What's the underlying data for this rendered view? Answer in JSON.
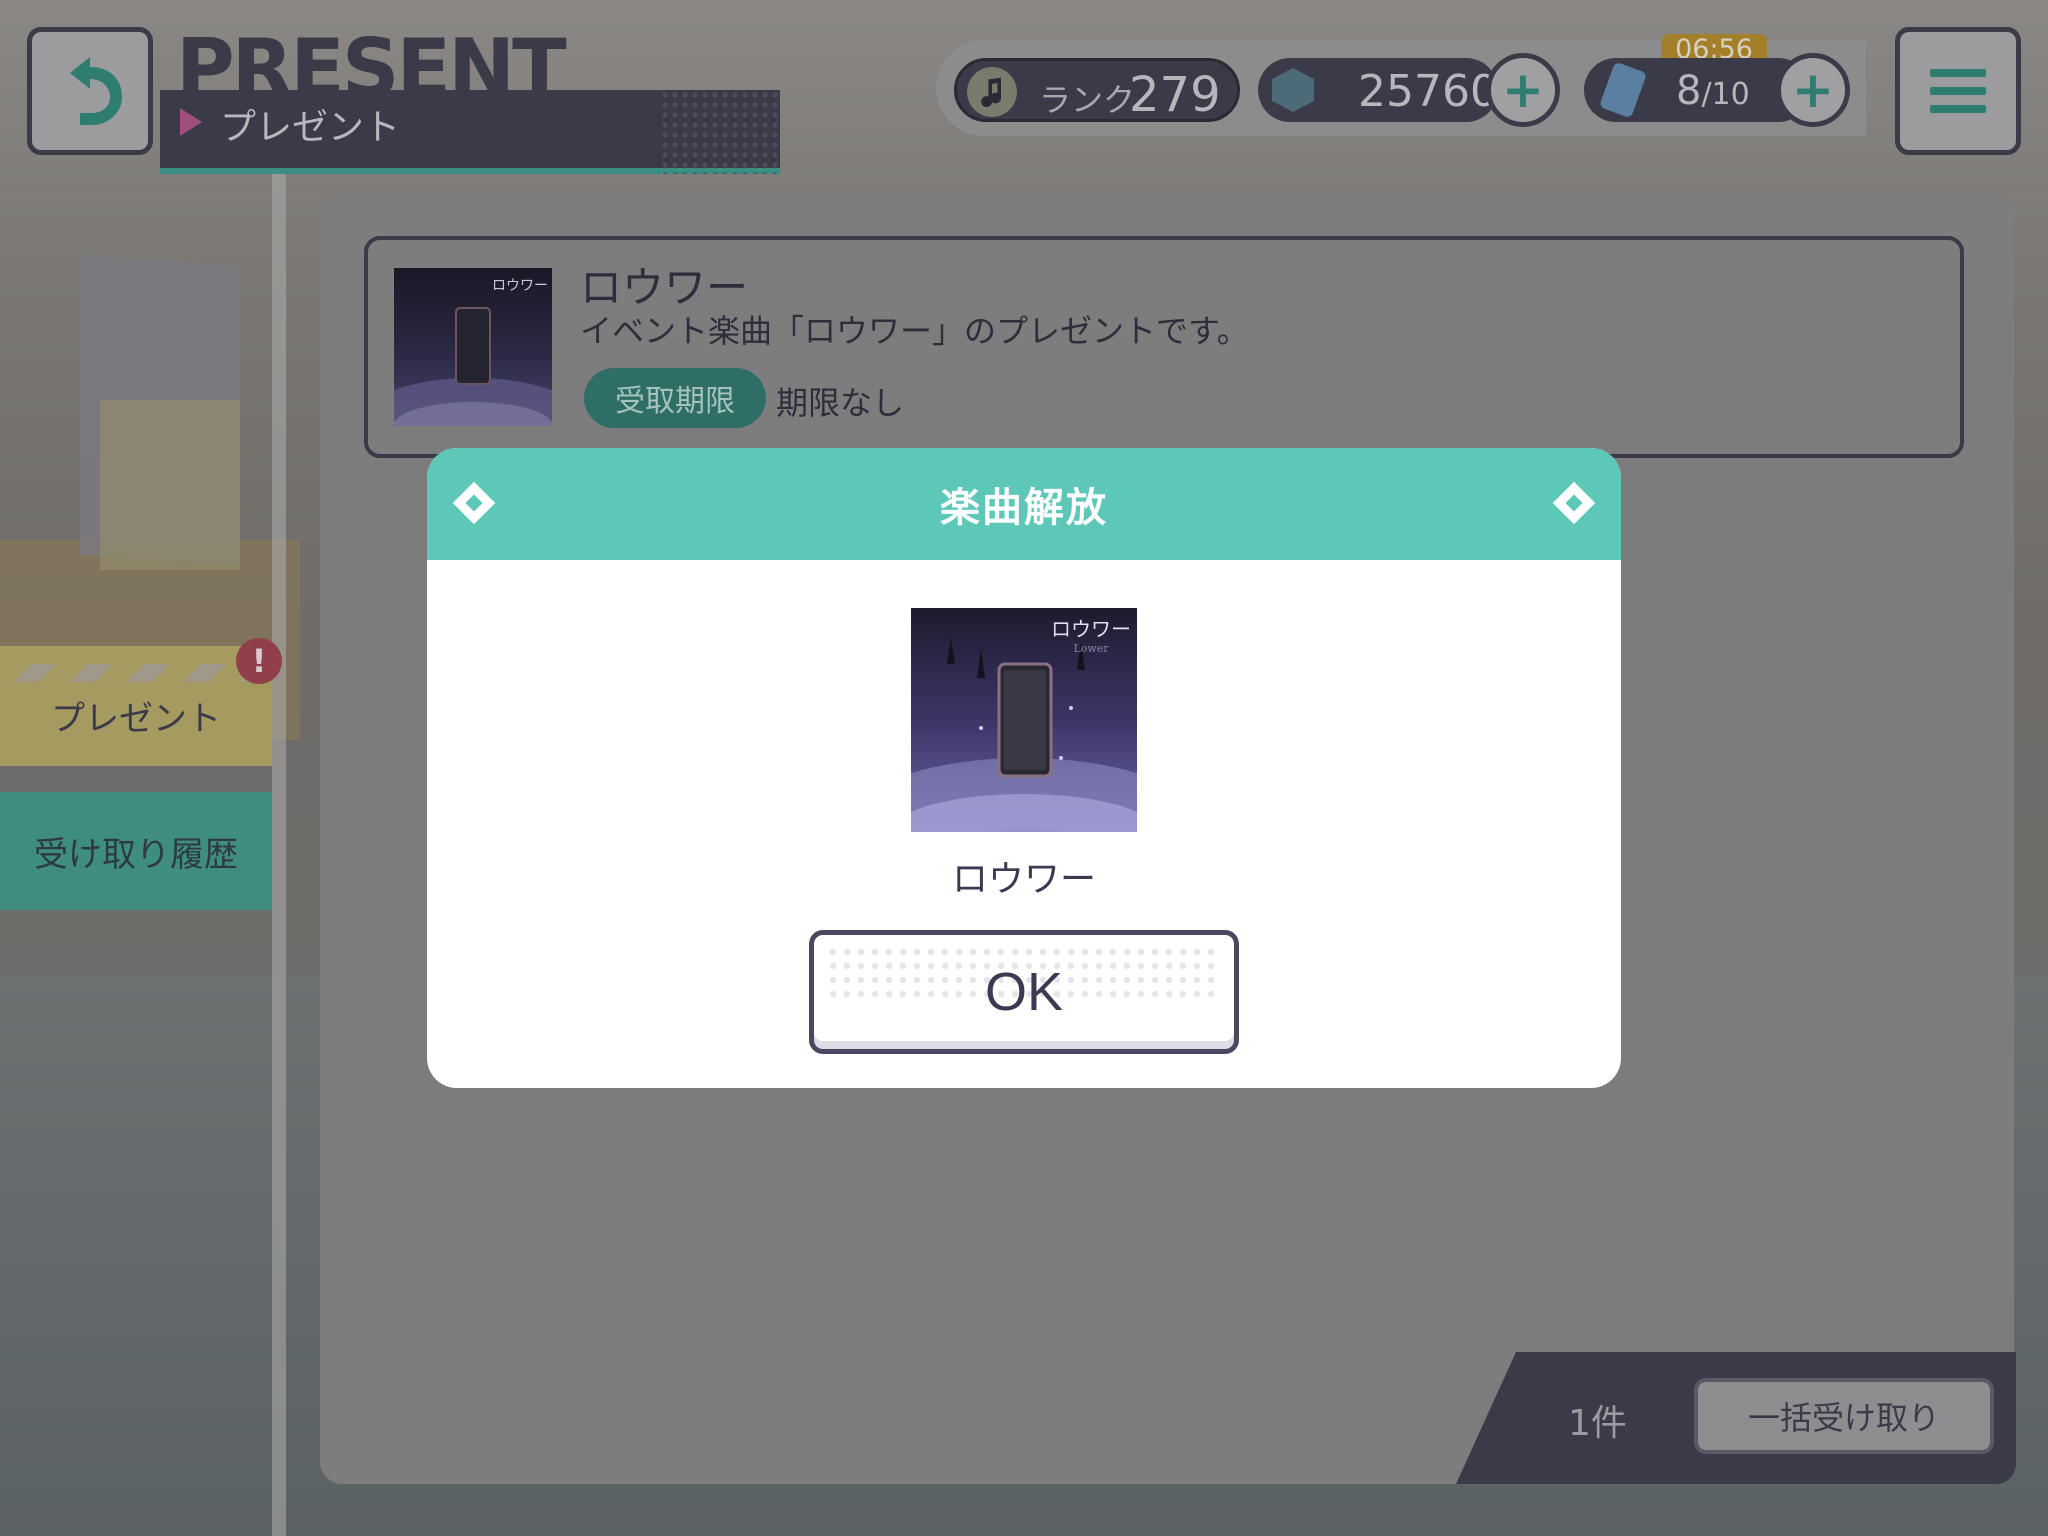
{
  "header": {
    "title_en": "PRESENT",
    "title_jp": "プレゼント"
  },
  "status": {
    "rank_label": "ランク",
    "rank_value": "279",
    "gems": "25760",
    "energy_current": "8",
    "energy_max": "/10",
    "energy_timer": "06:56"
  },
  "sidebar": {
    "tabs": [
      {
        "label": "プレゼント",
        "selected": true,
        "alert": "!"
      },
      {
        "label": "受け取り履歴",
        "selected": false
      }
    ]
  },
  "present_item": {
    "jacket_title": "ロウワー",
    "jacket_subtitle": "Lower",
    "title": "ロウワー",
    "description": "イベント楽曲「ロウワー」のプレゼントです。",
    "deadline_label": "受取期限",
    "deadline_value": "期限なし"
  },
  "footer": {
    "count": "1件",
    "bulk_receive_label": "一括受け取り"
  },
  "modal": {
    "title": "楽曲解放",
    "song_name": "ロウワー",
    "jacket_title": "ロウワー",
    "jacket_subtitle": "Lower",
    "ok_label": "OK"
  },
  "colors": {
    "accent_teal": "#5ec8b8",
    "dark_navy": "#3a3a48",
    "alert_red": "#913f4a"
  }
}
